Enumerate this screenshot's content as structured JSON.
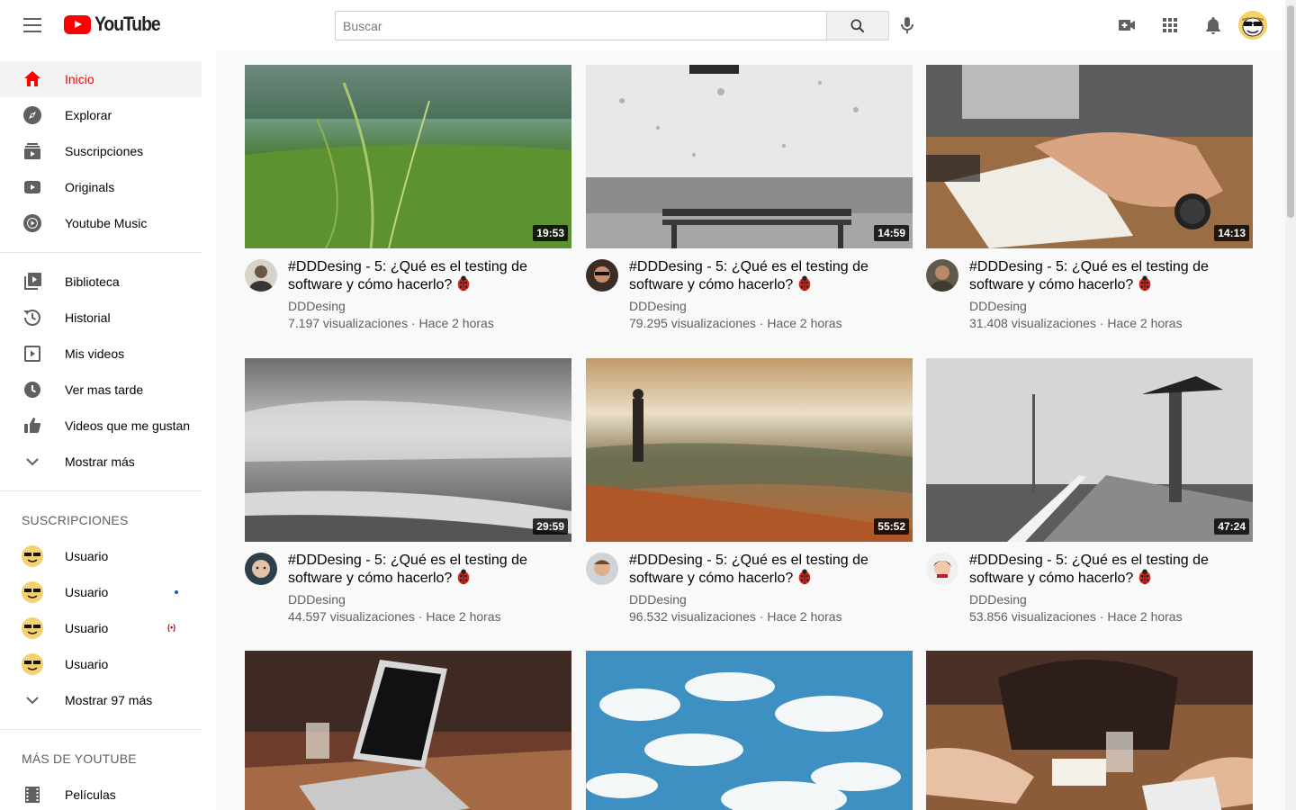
{
  "header": {
    "logo_text": "YouTube",
    "search_placeholder": "Buscar"
  },
  "sidebar": {
    "main": [
      {
        "label": "Inicio",
        "icon": "home-icon",
        "active": true
      },
      {
        "label": "Explorar",
        "icon": "compass-icon"
      },
      {
        "label": "Suscripciones",
        "icon": "subscriptions-icon"
      },
      {
        "label": "Originals",
        "icon": "originals-icon"
      },
      {
        "label": "Youtube Music",
        "icon": "music-icon"
      }
    ],
    "library": [
      {
        "label": "Biblioteca",
        "icon": "library-icon"
      },
      {
        "label": "Historial",
        "icon": "history-icon"
      },
      {
        "label": "Mis videos",
        "icon": "my-videos-icon"
      },
      {
        "label": "Ver mas tarde",
        "icon": "watch-later-icon"
      },
      {
        "label": "Videos que me gustan",
        "icon": "thumbs-up-icon"
      },
      {
        "label": "Mostrar más",
        "icon": "chevron-down-icon"
      }
    ],
    "subscriptions_heading": "SUSCRIPCIONES",
    "subscriptions": [
      {
        "label": "Usuario",
        "indicator": "none"
      },
      {
        "label": "Usuario",
        "indicator": "new"
      },
      {
        "label": "Usuario",
        "indicator": "live"
      },
      {
        "label": "Usuario",
        "indicator": "none"
      }
    ],
    "show_more_subs": "Mostrar 97 más",
    "more_heading": "MÁS DE YOUTUBE",
    "more": [
      {
        "label": "Películas",
        "icon": "film-icon"
      }
    ]
  },
  "videos": [
    {
      "title": "#DDDesing - 5: ¿Qué es el testing de software y cómo hacerlo?",
      "channel": "DDDesing",
      "views": "7.197 visualizaciones",
      "age": "Hace 2 horas",
      "duration": "19:53",
      "thumb": "grass"
    },
    {
      "title": "#DDDesing - 5: ¿Qué es el testing de software y cómo hacerlo?",
      "channel": "DDDesing",
      "views": "79.295 visualizaciones",
      "age": "Hace 2 horas",
      "duration": "14:59",
      "thumb": "wall"
    },
    {
      "title": "#DDDesing - 5: ¿Qué es el testing de software y cómo hacerlo?",
      "channel": "DDDesing",
      "views": "31.408 visualizaciones",
      "age": "Hace 2 horas",
      "duration": "14:13",
      "thumb": "notebook"
    },
    {
      "title": "#DDDesing - 5: ¿Qué es el testing de software y cómo hacerlo?",
      "channel": "DDDesing",
      "views": "44.597 visualizaciones",
      "age": "Hace 2 horas",
      "duration": "29:59",
      "thumb": "sea-bw"
    },
    {
      "title": "#DDDesing - 5: ¿Qué es el testing de software y cómo hacerlo?",
      "channel": "DDDesing",
      "views": "96.532 visualizaciones",
      "age": "Hace 2 horas",
      "duration": "55:52",
      "thumb": "beach"
    },
    {
      "title": "#DDDesing - 5: ¿Qué es el testing de software y cómo hacerlo?",
      "channel": "DDDesing",
      "views": "53.856 visualizaciones",
      "age": "Hace 2 horas",
      "duration": "47:24",
      "thumb": "pier"
    },
    {
      "title": "",
      "channel": "",
      "views": "",
      "age": "",
      "duration": "",
      "thumb": "laptop"
    },
    {
      "title": "",
      "channel": "",
      "views": "",
      "age": "",
      "duration": "",
      "thumb": "sky"
    },
    {
      "title": "",
      "channel": "",
      "views": "",
      "age": "",
      "duration": "",
      "thumb": "table"
    }
  ],
  "colors": {
    "brand_red": "#ff0000",
    "text_primary": "#030303",
    "text_secondary": "#606060",
    "background": "#f9f9f9"
  }
}
